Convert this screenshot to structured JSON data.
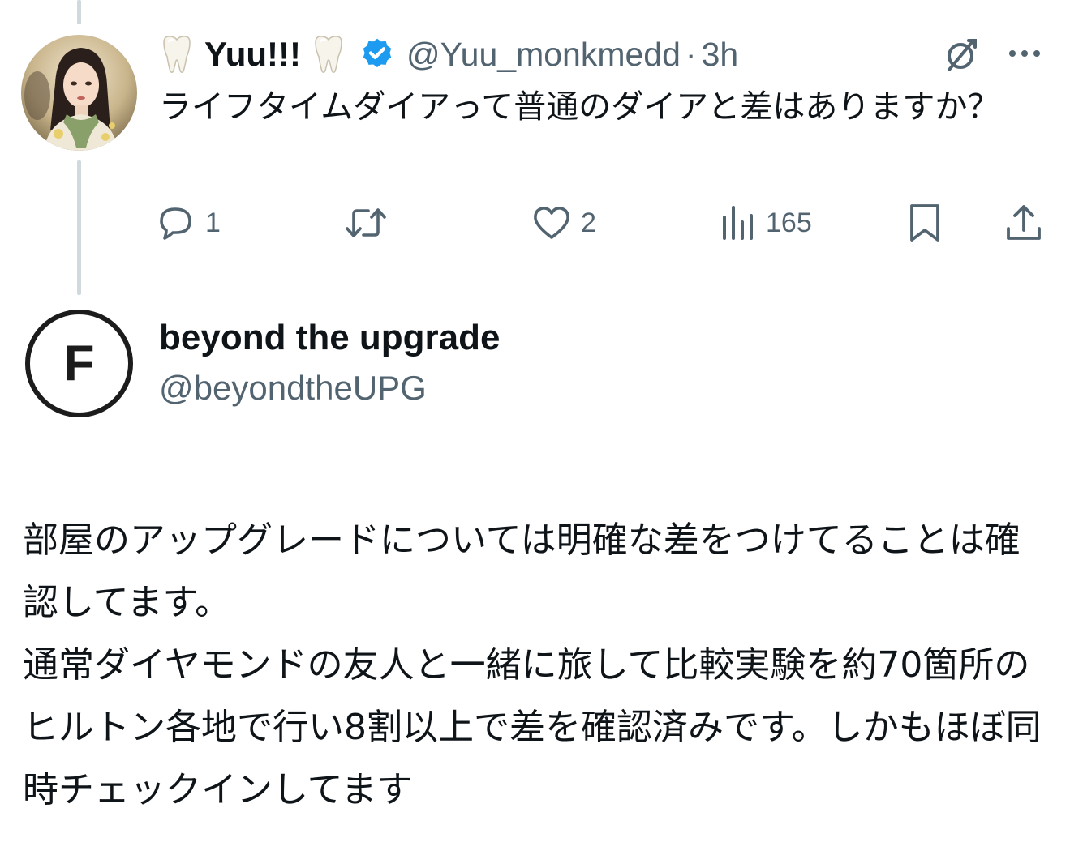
{
  "parent_tweet": {
    "display_name": "Yuu!!!",
    "name_emoji": "tooth",
    "verified": true,
    "handle": "@Yuu_monkmedd",
    "separator": "·",
    "time": "3h",
    "text": "ライフタイムダイアって普通のダイアと差はありますか？",
    "actions": {
      "replies": "1",
      "reposts": "",
      "likes": "2",
      "views": "165"
    },
    "icons": {
      "grok": "grok-icon",
      "more": "more-icon",
      "reply": "reply-icon",
      "repost": "repost-icon",
      "like": "heart-icon",
      "views": "views-icon",
      "bookmark": "bookmark-icon",
      "share": "share-icon"
    }
  },
  "reply_tweet": {
    "avatar_letter": "F",
    "display_name": "beyond the upgrade",
    "handle": "@beyondtheUPG",
    "text": "部屋のアップグレードについては明確な差をつけてることは確認してます。\n通常ダイヤモンドの友人と一緒に旅して比較実験を約70箇所のヒルトン各地で行い8割以上で差を確認済みです。しかもほぼ同時チェックインしてます"
  },
  "colors": {
    "text_primary": "#0f1419",
    "text_secondary": "#536471",
    "verified_blue": "#1d9bf0",
    "thread_line": "#cfd9de"
  }
}
